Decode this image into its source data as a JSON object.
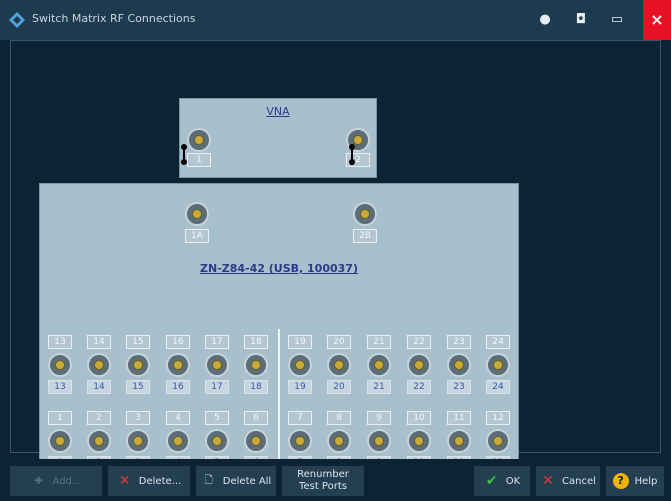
{
  "window": {
    "title": "Switch Matrix RF Connections",
    "colors": {
      "titlebar": "#1d3a4e",
      "background": "#0d2232",
      "device": "#a8bfcc",
      "close": "#e81123"
    }
  },
  "vna": {
    "title": "VNA",
    "ports": [
      "1",
      "2"
    ]
  },
  "matrix": {
    "title": "ZN-Z84-42 (USB, 100037)",
    "inputs": [
      "1A",
      "2B"
    ],
    "top_row_labels": [
      "13",
      "14",
      "15",
      "16",
      "17",
      "18",
      "19",
      "20",
      "21",
      "22",
      "23",
      "24"
    ],
    "top_row_ports": [
      "13",
      "14",
      "15",
      "16",
      "17",
      "18",
      "19",
      "20",
      "21",
      "22",
      "23",
      "24"
    ],
    "bottom_row_labels": [
      "1",
      "2",
      "3",
      "4",
      "5",
      "6",
      "7",
      "8",
      "9",
      "10",
      "11",
      "12"
    ],
    "bottom_row_ports": [
      "1",
      "2",
      "3",
      "4",
      "5",
      "6",
      "7",
      "8",
      "9",
      "10",
      "11",
      "12"
    ]
  },
  "buttons": {
    "add": "Add...",
    "delete": "Delete...",
    "delete_all": "Delete All",
    "renumber_line1": "Renumber",
    "renumber_line2": "Test Ports",
    "ok": "OK",
    "cancel": "Cancel",
    "help": "Help"
  },
  "icons": {
    "add": "plus-icon",
    "delete": "x-icon",
    "delete_all": "delete-all-icon",
    "ok": "check-icon",
    "cancel": "x-icon",
    "help": "question-icon"
  }
}
